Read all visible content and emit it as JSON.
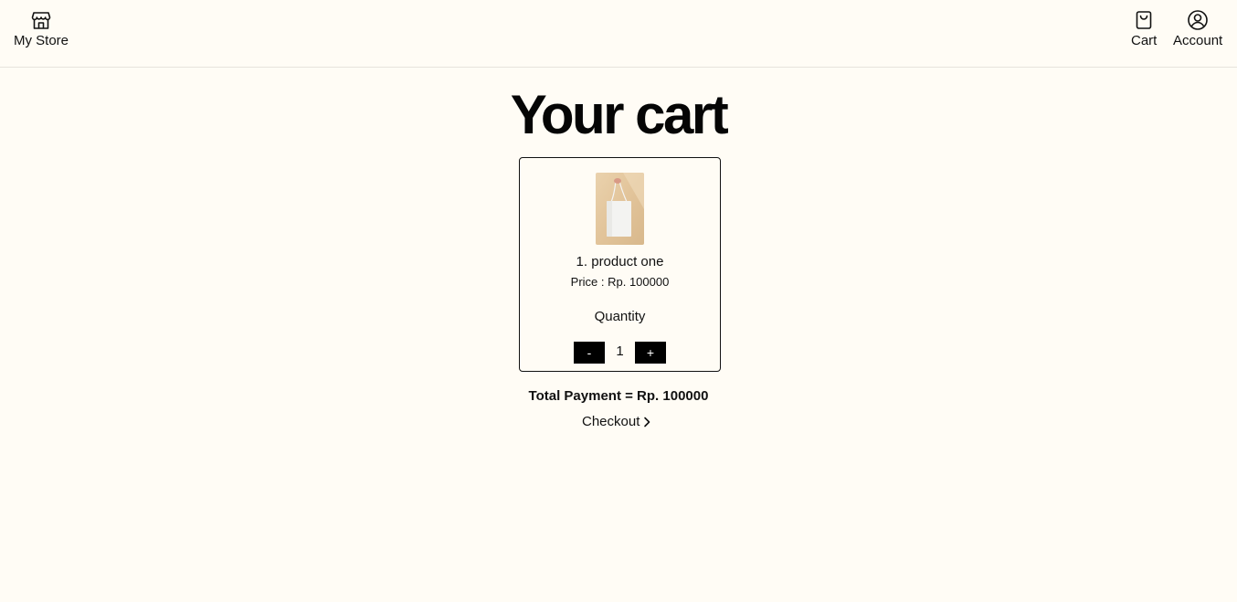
{
  "header": {
    "store_label": "My Store",
    "cart_label": "Cart",
    "account_label": "Account"
  },
  "page": {
    "title": "Your cart"
  },
  "cart_items": [
    {
      "name": "1. product one",
      "price_text": "Price : Rp. 100000",
      "quantity_label": "Quantity",
      "quantity": "1",
      "minus_label": "-",
      "plus_label": "+"
    }
  ],
  "summary": {
    "total_text": "Total Payment = Rp. 100000",
    "checkout_label": "Checkout"
  },
  "icons": {
    "store": "storefront-icon",
    "cart": "shopping-bag-icon",
    "account": "user-circle-icon",
    "checkout": "chevron-right-icon"
  },
  "colors": {
    "background": "#fffcf5",
    "button": "#000000",
    "text": "#111111"
  }
}
